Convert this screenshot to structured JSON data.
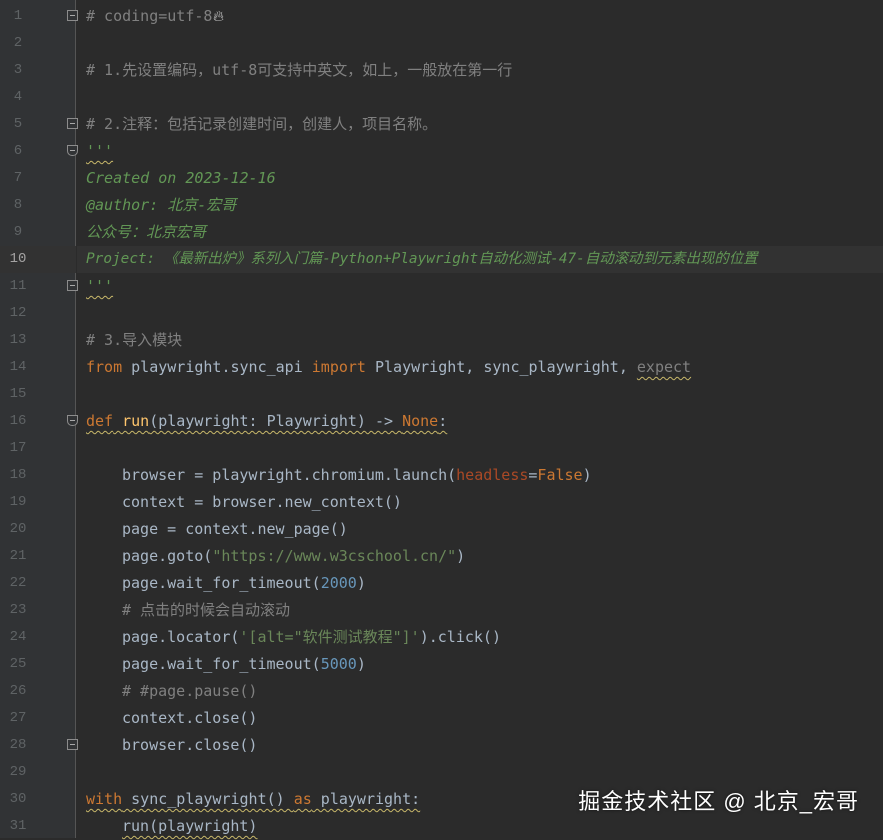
{
  "line_numbers": [
    "1",
    "2",
    "3",
    "4",
    "5",
    "6",
    "7",
    "8",
    "9",
    "10",
    "11",
    "12",
    "13",
    "14",
    "15",
    "16",
    "17",
    "18",
    "19",
    "20",
    "21",
    "22",
    "23",
    "24",
    "25",
    "26",
    "27",
    "28",
    "29",
    "30",
    "31"
  ],
  "code": {
    "l1": "# coding=utf-8",
    "l3": "# 1.先设置编码，utf-8可支持中英文，如上，一般放在第一行",
    "l5": "# 2.注释：包括记录创建时间，创建人，项目名称。",
    "l6": "'''",
    "l7": "Created on 2023-12-16",
    "l8": "@author: 北京-宏哥",
    "l9": "公众号：北京宏哥",
    "l10": "Project: 《最新出炉》系列入门篇-Python+Playwright自动化测试-47-自动滚动到元素出现的位置",
    "l11": "'''",
    "l13": "# 3.导入模块",
    "l14": {
      "from": "from",
      "mod": " playwright.sync_api ",
      "import": "import",
      "names": " Playwright, sync_playwright, ",
      "expect": "expect"
    },
    "l16": {
      "def": "def",
      "name": " run",
      "sig1": "(playwright: Playwright) -> ",
      "none": "None",
      "colon": ":"
    },
    "l18": {
      "a": "browser = playwright.chromium.launch(",
      "p": "headless",
      "eq": "=",
      "f": "False",
      "b": ")"
    },
    "l19": "context = browser.new_context()",
    "l20": "page = context.new_page()",
    "l21": {
      "a": "page.goto(",
      "s": "\"https://www.w3cschool.cn/\"",
      "b": ")"
    },
    "l22": {
      "a": "page.wait_for_timeout(",
      "n": "2000",
      "b": ")"
    },
    "l23": "# 点击的时候会自动滚动",
    "l24": {
      "a": "page.locator(",
      "s": "'[alt=\"软件测试教程\"]'",
      "b": ").click()"
    },
    "l25": {
      "a": "page.wait_for_timeout(",
      "n": "5000",
      "b": ")"
    },
    "l26": "# #page.pause()",
    "l27": "context.close()",
    "l28": "browser.close()",
    "l30": {
      "with": "with",
      "mid": " sync_playwright() ",
      "as": "as",
      "tail": " playwright:"
    },
    "l31": "run(playwright)"
  },
  "watermark": "掘金技术社区 @ 北京_宏哥",
  "colors": {
    "background": "#2b2b2b",
    "gutter": "#313335",
    "comment": "#808080",
    "docstring": "#629755",
    "keyword": "#cc7832",
    "string": "#6a8759",
    "number": "#6897bb",
    "param": "#aa4926",
    "text": "#a9b7c6"
  }
}
